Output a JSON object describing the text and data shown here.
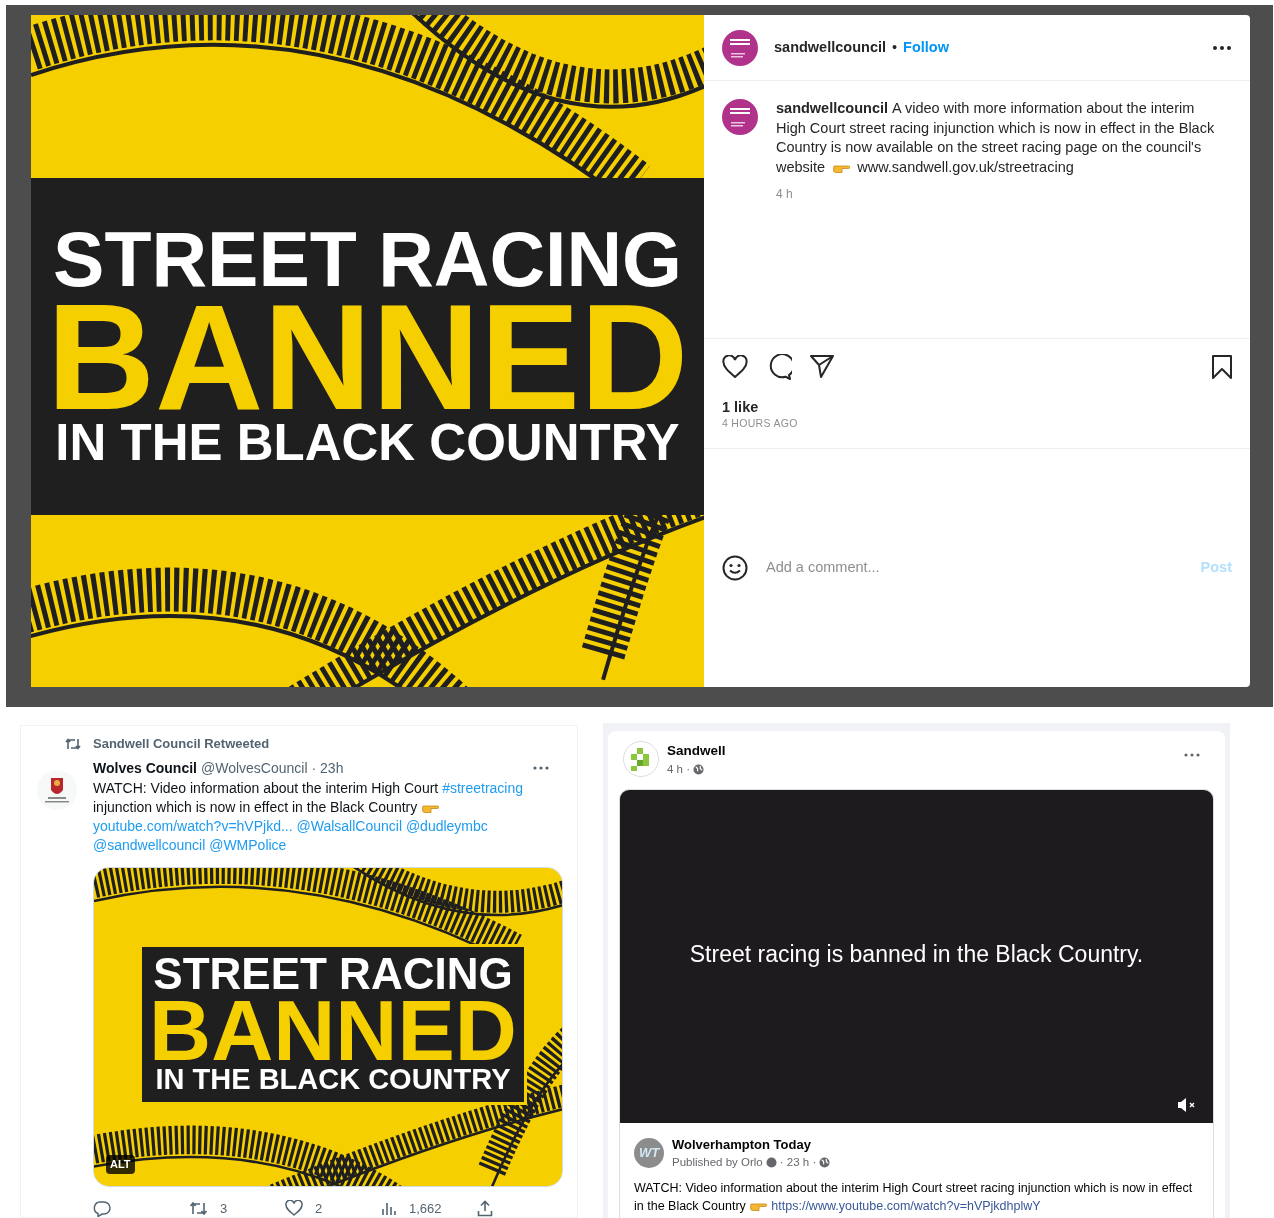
{
  "instagram": {
    "banner": {
      "kind": "banner",
      "lines": [
        "STREET RACING",
        "BANNED",
        "IN THE BLACK COUNTRY"
      ]
    },
    "header": {
      "username": "sandwellcouncil",
      "separator": "•",
      "follow": "Follow"
    },
    "caption": {
      "username": "sandwellcouncil",
      "text": "A video with more information about the interim High Court street racing injunction which is now in effect in the Black Country is now available on the street racing page on the council's website",
      "link": "www.sandwell.gov.uk/streetracing",
      "time": "4 h"
    },
    "likes": "1 like",
    "posted": "4 HOURS AGO",
    "comment": {
      "placeholder": "Add a comment...",
      "post": "Post",
      "disabled": true
    }
  },
  "tweet": {
    "retweeted_by": "Sandwell Council Retweeted",
    "name": "Wolves Council",
    "handle": "@WolvesCouncil",
    "time": "· 23h",
    "segments": [
      {
        "kind": "text",
        "text": "WATCH: Video information about the interim High Court "
      },
      {
        "kind": "link",
        "text": "#streetracing"
      },
      {
        "kind": "text",
        "text": " injunction which is now in effect in the Black Country "
      },
      {
        "kind": "emoji"
      },
      {
        "kind": "link",
        "text": "youtube.com/watch?v=hVPjkd..."
      },
      {
        "kind": "link",
        "text": "@WalsallCouncil"
      },
      {
        "kind": "link",
        "text": "@dudleymbc"
      },
      {
        "kind": "link",
        "text": "@sandwellcouncil"
      },
      {
        "kind": "link",
        "text": "@WMPolice"
      }
    ],
    "banner": {
      "kind": "banner",
      "lines": [
        "STREET RACING",
        "BANNED",
        "IN THE BLACK COUNTRY"
      ]
    },
    "alt": "ALT",
    "stats": [
      {
        "kind": "reply"
      },
      {
        "kind": "retweet",
        "count": "3"
      },
      {
        "kind": "like",
        "count": "2"
      },
      {
        "kind": "views",
        "count": "1,662"
      },
      {
        "kind": "share"
      }
    ]
  },
  "facebook": {
    "page": "Sandwell",
    "meta": "4 h ·",
    "video": {
      "caption": "Street racing is banned in the Black Country.",
      "muted": true
    },
    "shared": {
      "avatar_text": "WT",
      "name": "Wolverhampton Today",
      "published": "Published by Orlo",
      "meta": "· 23 h ·",
      "text": "WATCH: Video information about the interim High Court street racing injunction which is now in effect in the Black Country",
      "link": "https://www.youtube.com/watch?v=hVPjkdhplwY"
    }
  }
}
